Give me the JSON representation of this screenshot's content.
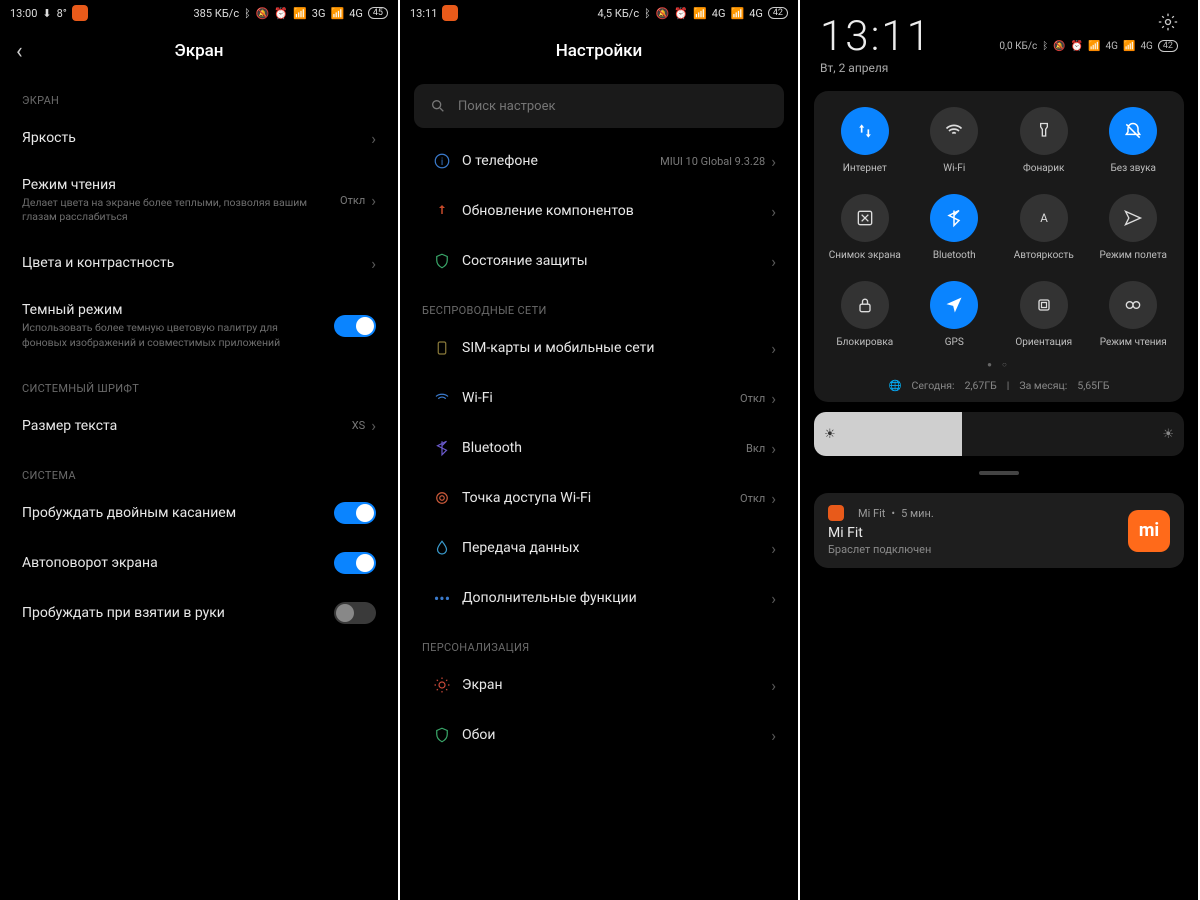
{
  "s1": {
    "status": {
      "time": "13:00",
      "temp": "8°",
      "rate": "385 КБ/с",
      "net1": "3G",
      "net2": "4G",
      "batt": "45"
    },
    "title": "Экран",
    "sect_screen": "ЭКРАН",
    "sect_font": "СИСТЕМНЫЙ ШРИФТ",
    "sect_sys": "СИСТЕМА",
    "brightness": "Яркость",
    "reading": {
      "t": "Режим чтения",
      "d": "Делает цвета на экране более теплыми, позволяя вашим глазам расслабиться",
      "v": "Откл"
    },
    "colors": "Цвета и контрастность",
    "dark": {
      "t": "Темный режим",
      "d": "Использовать более темную цветовую палитру для фоновых изображений и совместимых приложений"
    },
    "textsize": {
      "t": "Размер текста",
      "v": "XS"
    },
    "dbltap": "Пробуждать двойным касанием",
    "autorotate": "Автоповорот экрана",
    "raisewake": "Пробуждать при взятии в руки"
  },
  "s2": {
    "status": {
      "time": "13:11",
      "rate": "4,5 КБ/с",
      "net1": "4G",
      "net2": "4G",
      "batt": "42"
    },
    "title": "Настройки",
    "search_ph": "Поиск настроек",
    "about": {
      "t": "О телефоне",
      "v": "MIUI 10 Global 9.3.28"
    },
    "update": "Обновление компонентов",
    "security": "Состояние защиты",
    "sect_wireless": "БЕСПРОВОДНЫЕ СЕТИ",
    "sim": "SIM-карты и мобильные сети",
    "wifi": {
      "t": "Wi-Fi",
      "v": "Откл"
    },
    "bt": {
      "t": "Bluetooth",
      "v": "Вкл"
    },
    "hotspot": {
      "t": "Точка доступа Wi-Fi",
      "v": "Откл"
    },
    "datatrans": "Передача данных",
    "more": "Дополнительные функции",
    "sect_pers": "ПЕРСОНАЛИЗАЦИЯ",
    "display": "Экран",
    "wallpaper": "Обои"
  },
  "s3": {
    "clock": "13:11",
    "date": "Вт, 2 апреля",
    "status": {
      "rate": "0,0 КБ/с",
      "net1": "4G",
      "net2": "4G",
      "batt": "42"
    },
    "tiles": [
      {
        "n": "Интернет",
        "on": true
      },
      {
        "n": "Wi-Fi",
        "on": false
      },
      {
        "n": "Фонарик",
        "on": false
      },
      {
        "n": "Без звука",
        "on": true
      },
      {
        "n": "Снимок экрана",
        "on": false
      },
      {
        "n": "Bluetooth",
        "on": true
      },
      {
        "n": "Автояркость",
        "on": false
      },
      {
        "n": "Режим полета",
        "on": false
      },
      {
        "n": "Блокировка",
        "on": false
      },
      {
        "n": "GPS",
        "on": true
      },
      {
        "n": "Ориентация",
        "on": false
      },
      {
        "n": "Режим чтения",
        "on": false
      }
    ],
    "usage": {
      "today_l": "Сегодня:",
      "today_v": "2,67ГБ",
      "sep": "|",
      "month_l": "За месяц:",
      "month_v": "5,65ГБ"
    },
    "notif": {
      "app": "Mi Fit",
      "time": "5 мин.",
      "title": "Mi Fit",
      "body": "Браслет подключен"
    }
  }
}
